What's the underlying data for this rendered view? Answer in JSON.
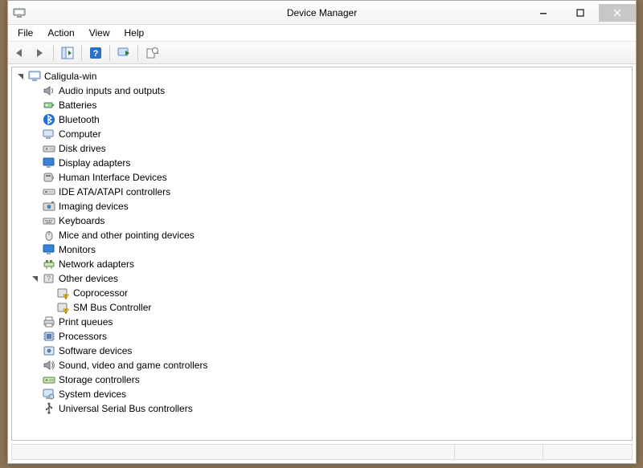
{
  "window": {
    "title": "Device Manager"
  },
  "menubar": [
    "File",
    "Action",
    "View",
    "Help"
  ],
  "toolbar": {
    "back": "back-icon",
    "forward": "forward-icon",
    "show_hide": "show-hide-tree-icon",
    "help": "help-icon",
    "scan": "scan-hardware-icon",
    "props": "properties-icon"
  },
  "tree": {
    "root": {
      "label": "Caligula-win",
      "icon": "computer-root-icon",
      "expanded": true,
      "children": [
        {
          "label": "Audio inputs and outputs",
          "icon": "audio-icon",
          "expanded": false
        },
        {
          "label": "Batteries",
          "icon": "battery-icon",
          "expanded": false
        },
        {
          "label": "Bluetooth",
          "icon": "bluetooth-icon",
          "expanded": false
        },
        {
          "label": "Computer",
          "icon": "computer-icon",
          "expanded": false
        },
        {
          "label": "Disk drives",
          "icon": "disk-icon",
          "expanded": false
        },
        {
          "label": "Display adapters",
          "icon": "display-icon",
          "expanded": false
        },
        {
          "label": "Human Interface Devices",
          "icon": "hid-icon",
          "expanded": false
        },
        {
          "label": "IDE ATA/ATAPI controllers",
          "icon": "ide-icon",
          "expanded": false
        },
        {
          "label": "Imaging devices",
          "icon": "imaging-icon",
          "expanded": false
        },
        {
          "label": "Keyboards",
          "icon": "keyboard-icon",
          "expanded": false
        },
        {
          "label": "Mice and other pointing devices",
          "icon": "mouse-icon",
          "expanded": false
        },
        {
          "label": "Monitors",
          "icon": "monitor-icon",
          "expanded": false
        },
        {
          "label": "Network adapters",
          "icon": "network-icon",
          "expanded": false
        },
        {
          "label": "Other devices",
          "icon": "other-icon",
          "expanded": true,
          "children": [
            {
              "label": "Coprocessor",
              "icon": "warning-device-icon"
            },
            {
              "label": "SM Bus Controller",
              "icon": "warning-device-icon"
            }
          ]
        },
        {
          "label": "Print queues",
          "icon": "printer-icon",
          "expanded": false
        },
        {
          "label": "Processors",
          "icon": "cpu-icon",
          "expanded": false
        },
        {
          "label": "Software devices",
          "icon": "software-icon",
          "expanded": false
        },
        {
          "label": "Sound, video and game controllers",
          "icon": "sound-icon",
          "expanded": false
        },
        {
          "label": "Storage controllers",
          "icon": "storage-icon",
          "expanded": false
        },
        {
          "label": "System devices",
          "icon": "system-icon",
          "expanded": false
        },
        {
          "label": "Universal Serial Bus controllers",
          "icon": "usb-icon",
          "expanded": false
        }
      ]
    }
  }
}
